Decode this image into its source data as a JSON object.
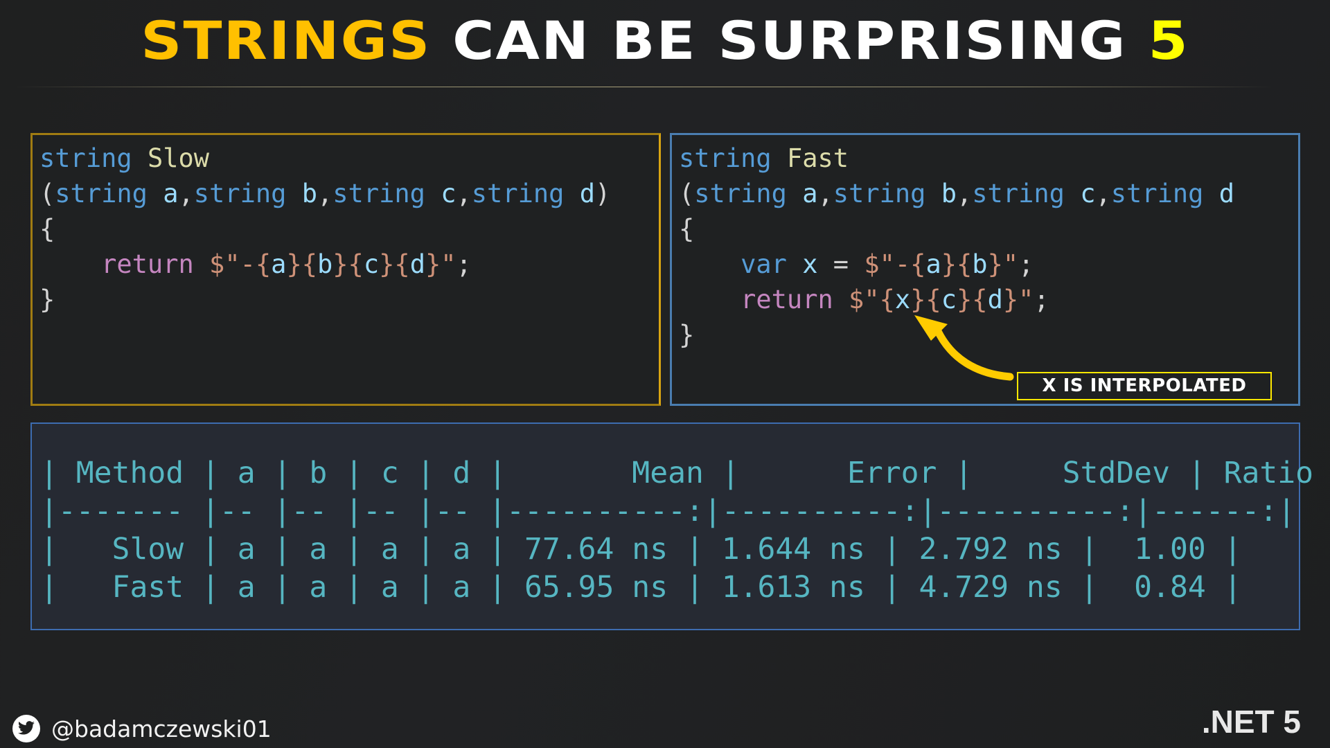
{
  "title": {
    "part1": "STRINGS",
    "part2": " CAN BE SURPRISING ",
    "part3": "5"
  },
  "colors": {
    "title_accent": "#ffc000",
    "title_number": "#ffff00",
    "slow_border": "#d9a512",
    "fast_border": "#4a7db0",
    "bench_text": "#56b6c2",
    "callout_border": "#ffe800",
    "arrow": "#ffcc00"
  },
  "slow_code": {
    "l1_kw": "string",
    "l1_name": "Slow",
    "l2_open": "(",
    "l2_t1": "string",
    "l2_p1": "a",
    "l2_c1": ",",
    "l2_t2": "string",
    "l2_p2": "b",
    "l2_c2": ",",
    "l2_t3": "string",
    "l2_p3": "c",
    "l2_c3": ",",
    "l2_t4": "string",
    "l2_p4": "d",
    "l2_close": ")",
    "l3": "{",
    "l4_indent": "    ",
    "l4_ret": "return",
    "l4_s1": "$\"-{",
    "l4_a": "a",
    "l4_s2": "}{",
    "l4_b": "b",
    "l4_s3": "}{",
    "l4_c": "c",
    "l4_s4": "}{",
    "l4_d": "d",
    "l4_s5": "}\"",
    "l4_semi": ";",
    "l5": "}"
  },
  "fast_code": {
    "l1_kw": "string",
    "l1_name": "Fast",
    "l2_open": "(",
    "l2_t1": "string",
    "l2_p1": "a",
    "l2_c1": ",",
    "l2_t2": "string",
    "l2_p2": "b",
    "l2_c2": ",",
    "l2_t3": "string",
    "l2_p3": "c",
    "l2_c3": ",",
    "l2_t4": "string",
    "l2_p4": "d",
    "l3": "{",
    "l4_indent": "    ",
    "l4_var": "var",
    "l4_x": "x",
    "l4_eq": " = ",
    "l4_s1": "$\"-{",
    "l4_a": "a",
    "l4_s2": "}{",
    "l4_b": "b",
    "l4_s3": "}\"",
    "l4_semi": ";",
    "l5_indent": "    ",
    "l5_ret": "return",
    "l5_s1": "$\"{",
    "l5_x": "x",
    "l5_s2": "}{",
    "l5_c": "c",
    "l5_s3": "}{",
    "l5_d": "d",
    "l5_s4": "}\"",
    "l5_semi": ";",
    "l6": "}"
  },
  "callout": {
    "label": "X IS INTERPOLATED"
  },
  "benchmark": {
    "header": "| Method | a | b | c | d |       Mean |      Error |     StdDev | Ratio |",
    "separator": "|------- |-- |-- |-- |-- |----------:|----------:|----------:|------:|",
    "columns": [
      "Method",
      "a",
      "b",
      "c",
      "d",
      "Mean",
      "Error",
      "StdDev",
      "Ratio"
    ],
    "rows": [
      {
        "method": "Slow",
        "a": "a",
        "b": "a",
        "c": "a",
        "d": "a",
        "mean": "77.64 ns",
        "error": "1.644 ns",
        "stddev": "2.792 ns",
        "ratio": "1.00",
        "line": "|   Slow | a | a | a | a | 77.64 ns | 1.644 ns | 2.792 ns |  1.00 |"
      },
      {
        "method": "Fast",
        "a": "a",
        "b": "a",
        "c": "a",
        "d": "a",
        "mean": "65.95 ns",
        "error": "1.613 ns",
        "stddev": "4.729 ns",
        "ratio": "0.84",
        "line": "|   Fast | a | a | a | a | 65.95 ns | 1.613 ns | 4.729 ns |  0.84 |"
      }
    ]
  },
  "footer": {
    "handle": "@badamczewski01",
    "handle_icon": "twitter-icon",
    "brand": ".NET 5"
  }
}
